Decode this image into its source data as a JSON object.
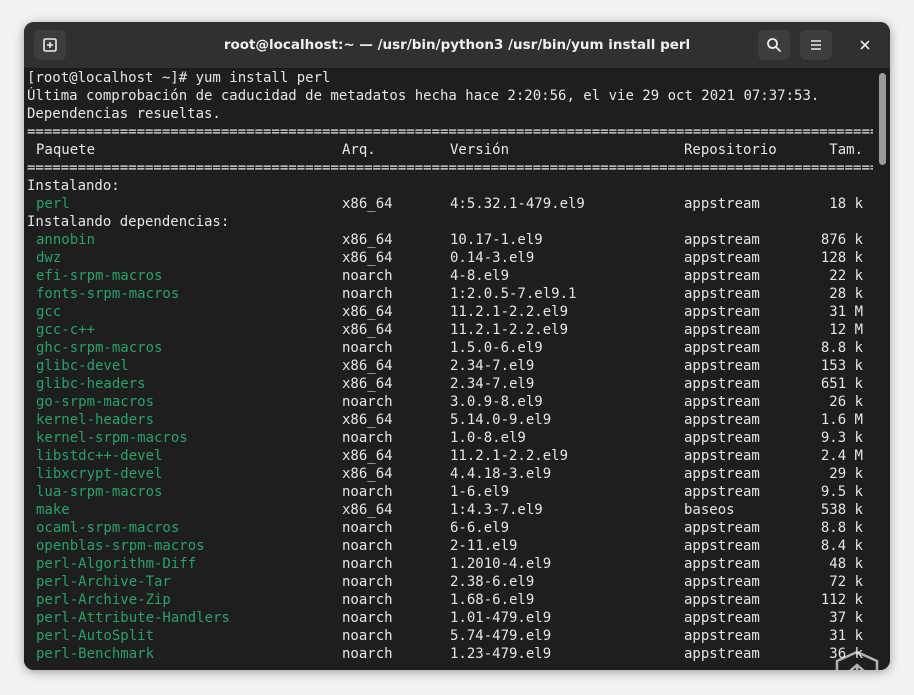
{
  "window": {
    "title": "root@localhost:~ — /usr/bin/python3 /usr/bin/yum install perl"
  },
  "terminal": {
    "prompt_line": "[root@localhost ~]# yum install perl",
    "metadata_line": "Última comprobación de caducidad de metadatos hecha hace 2:20:56, el vie 29 oct 2021 07:37:53.",
    "deps_resolved": "Dependencias resueltas.",
    "separator": "================================================================================================================================",
    "header": {
      "package": "Paquete",
      "arch": "Arq.",
      "version": "Versión",
      "repo": "Repositorio",
      "size": "Tam."
    },
    "section_installing": "Instalando:",
    "main_packages": [
      {
        "name": "perl",
        "arch": "x86_64",
        "version": "4:5.32.1-479.el9",
        "repo": "appstream",
        "size": "18 k"
      }
    ],
    "section_deps": "Instalando dependencias:",
    "dependencies": [
      {
        "name": "annobin",
        "arch": "x86_64",
        "version": "10.17-1.el9",
        "repo": "appstream",
        "size": "876 k"
      },
      {
        "name": "dwz",
        "arch": "x86_64",
        "version": "0.14-3.el9",
        "repo": "appstream",
        "size": "128 k"
      },
      {
        "name": "efi-srpm-macros",
        "arch": "noarch",
        "version": "4-8.el9",
        "repo": "appstream",
        "size": "22 k"
      },
      {
        "name": "fonts-srpm-macros",
        "arch": "noarch",
        "version": "1:2.0.5-7.el9.1",
        "repo": "appstream",
        "size": "28 k"
      },
      {
        "name": "gcc",
        "arch": "x86_64",
        "version": "11.2.1-2.2.el9",
        "repo": "appstream",
        "size": "31 M"
      },
      {
        "name": "gcc-c++",
        "arch": "x86_64",
        "version": "11.2.1-2.2.el9",
        "repo": "appstream",
        "size": "12 M"
      },
      {
        "name": "ghc-srpm-macros",
        "arch": "noarch",
        "version": "1.5.0-6.el9",
        "repo": "appstream",
        "size": "8.8 k"
      },
      {
        "name": "glibc-devel",
        "arch": "x86_64",
        "version": "2.34-7.el9",
        "repo": "appstream",
        "size": "153 k"
      },
      {
        "name": "glibc-headers",
        "arch": "x86_64",
        "version": "2.34-7.el9",
        "repo": "appstream",
        "size": "651 k"
      },
      {
        "name": "go-srpm-macros",
        "arch": "noarch",
        "version": "3.0.9-8.el9",
        "repo": "appstream",
        "size": "26 k"
      },
      {
        "name": "kernel-headers",
        "arch": "x86_64",
        "version": "5.14.0-9.el9",
        "repo": "appstream",
        "size": "1.6 M"
      },
      {
        "name": "kernel-srpm-macros",
        "arch": "noarch",
        "version": "1.0-8.el9",
        "repo": "appstream",
        "size": "9.3 k"
      },
      {
        "name": "libstdc++-devel",
        "arch": "x86_64",
        "version": "11.2.1-2.2.el9",
        "repo": "appstream",
        "size": "2.4 M"
      },
      {
        "name": "libxcrypt-devel",
        "arch": "x86_64",
        "version": "4.4.18-3.el9",
        "repo": "appstream",
        "size": "29 k"
      },
      {
        "name": "lua-srpm-macros",
        "arch": "noarch",
        "version": "1-6.el9",
        "repo": "appstream",
        "size": "9.5 k"
      },
      {
        "name": "make",
        "arch": "x86_64",
        "version": "1:4.3-7.el9",
        "repo": "baseos",
        "size": "538 k"
      },
      {
        "name": "ocaml-srpm-macros",
        "arch": "noarch",
        "version": "6-6.el9",
        "repo": "appstream",
        "size": "8.8 k"
      },
      {
        "name": "openblas-srpm-macros",
        "arch": "noarch",
        "version": "2-11.el9",
        "repo": "appstream",
        "size": "8.4 k"
      },
      {
        "name": "perl-Algorithm-Diff",
        "arch": "noarch",
        "version": "1.2010-4.el9",
        "repo": "appstream",
        "size": "48 k"
      },
      {
        "name": "perl-Archive-Tar",
        "arch": "noarch",
        "version": "2.38-6.el9",
        "repo": "appstream",
        "size": "72 k"
      },
      {
        "name": "perl-Archive-Zip",
        "arch": "noarch",
        "version": "1.68-6.el9",
        "repo": "appstream",
        "size": "112 k"
      },
      {
        "name": "perl-Attribute-Handlers",
        "arch": "noarch",
        "version": "1.01-479.el9",
        "repo": "appstream",
        "size": "37 k"
      },
      {
        "name": "perl-AutoSplit",
        "arch": "noarch",
        "version": "5.74-479.el9",
        "repo": "appstream",
        "size": "31 k"
      },
      {
        "name": "perl-Benchmark",
        "arch": "noarch",
        "version": "1.23-479.el9",
        "repo": "appstream",
        "size": "36 k"
      }
    ]
  },
  "colors": {
    "package_name": "#26a269",
    "terminal_bg": "#1e1e1e",
    "terminal_fg": "#e6e6e6",
    "titlebar_bg": "#303030"
  },
  "icons": {
    "new_tab": "new-tab-icon",
    "search": "search-icon",
    "menu": "hamburger-menu-icon",
    "close": "close-icon",
    "watermark": "watermark-logo-icon"
  }
}
